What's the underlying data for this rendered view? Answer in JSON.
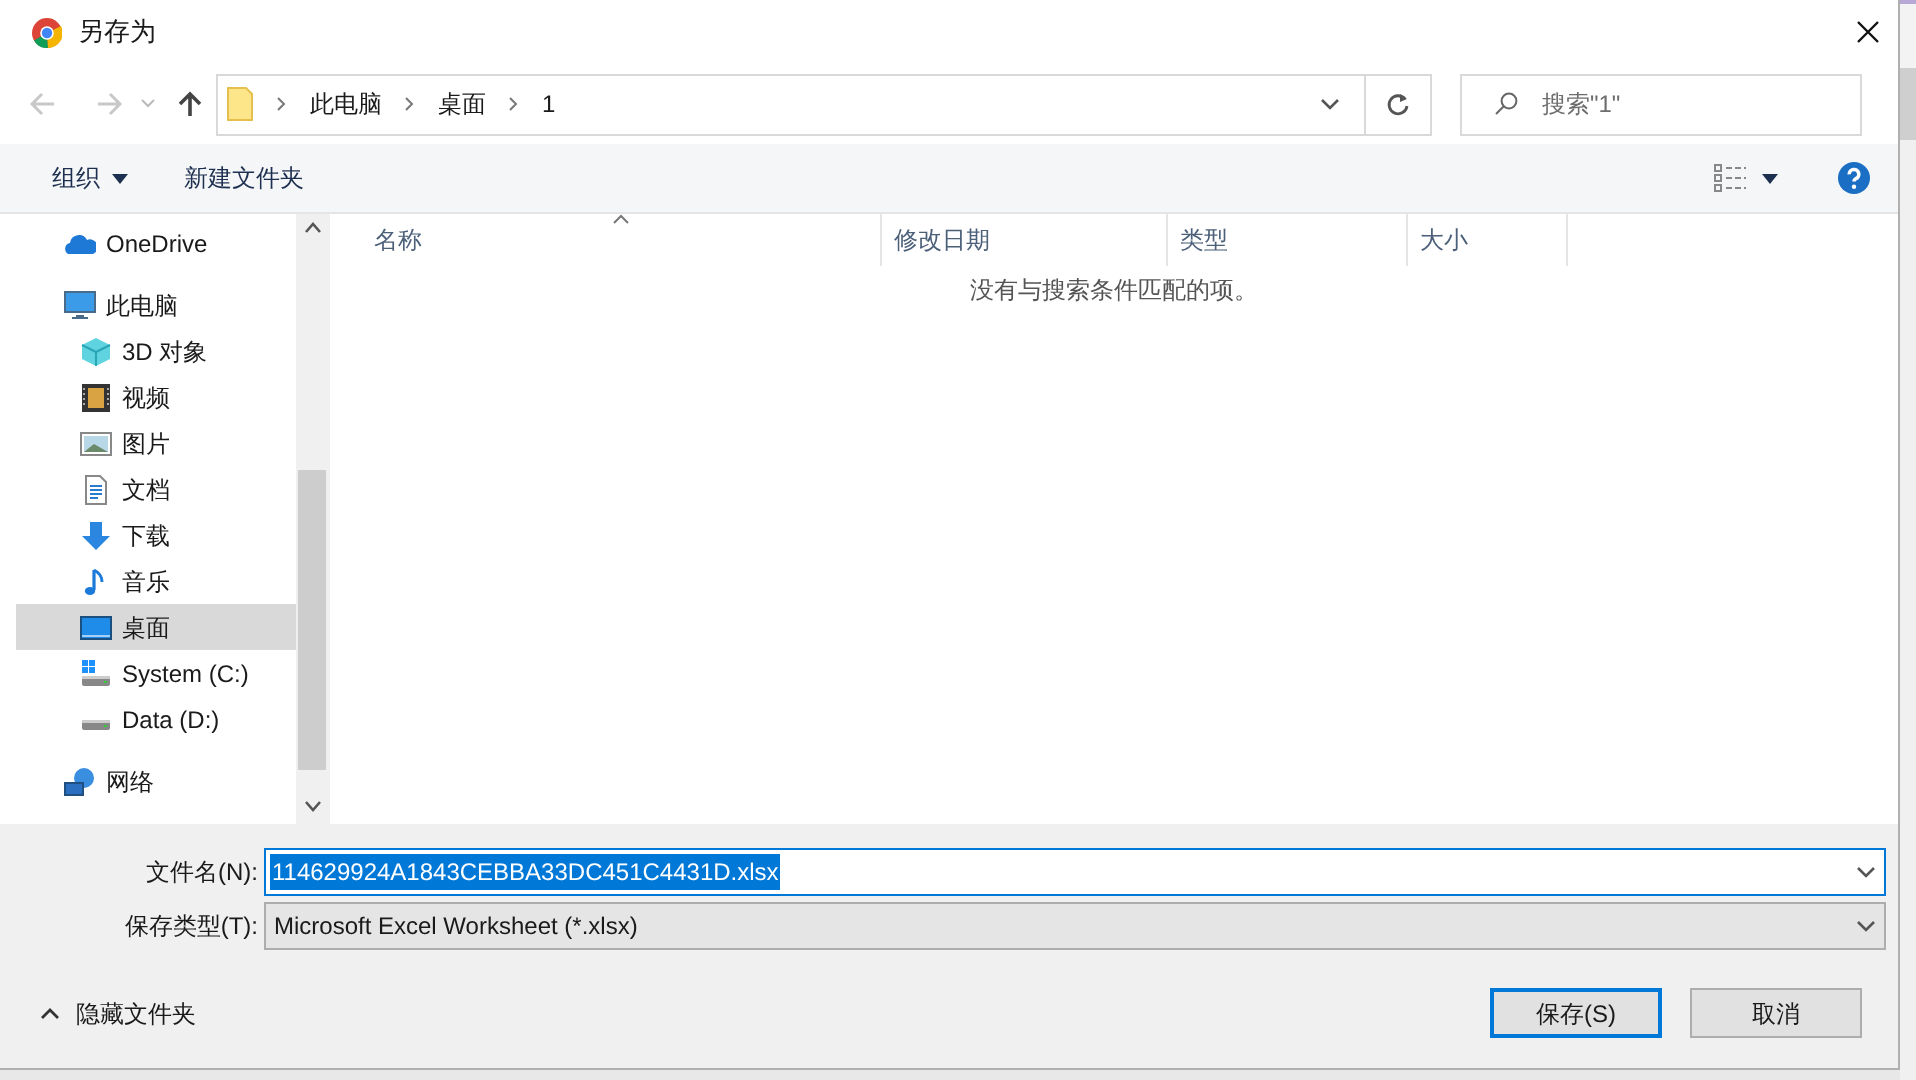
{
  "window": {
    "title": "另存为"
  },
  "nav": {
    "back_disabled": true,
    "forward_disabled": true,
    "breadcrumbs": [
      "此电脑",
      "桌面",
      "1"
    ],
    "search": {
      "placeholder": "搜索\"1\""
    }
  },
  "toolbar": {
    "organize": "组织",
    "new_folder": "新建文件夹"
  },
  "sidebar": {
    "items": [
      {
        "label": "OneDrive",
        "selected": false
      },
      {
        "label": "此电脑",
        "selected": false,
        "children": [
          {
            "label": "3D 对象",
            "selected": false
          },
          {
            "label": "视频",
            "selected": false
          },
          {
            "label": "图片",
            "selected": false
          },
          {
            "label": "文档",
            "selected": false
          },
          {
            "label": "下载",
            "selected": false
          },
          {
            "label": "音乐",
            "selected": false
          },
          {
            "label": "桌面",
            "selected": true
          },
          {
            "label": "System (C:)",
            "selected": false
          },
          {
            "label": "Data (D:)",
            "selected": false
          }
        ]
      },
      {
        "label": "网络",
        "selected": false
      }
    ]
  },
  "table": {
    "columns": [
      {
        "label": "名称",
        "sorted": true
      },
      {
        "label": "修改日期",
        "sorted": false
      },
      {
        "label": "类型",
        "sorted": false
      },
      {
        "label": "大小",
        "sorted": false
      }
    ],
    "empty_message": "没有与搜索条件匹配的项。"
  },
  "file_name": {
    "label": "文件名(N):",
    "value": "114629924A1843CEBBA33DC451C4431D.xlsx",
    "text_selected": true
  },
  "save_type": {
    "label": "保存类型(T):",
    "value": "Microsoft Excel Worksheet (*.xlsx)"
  },
  "hide_folders": {
    "label": "隐藏文件夹",
    "expanded": true
  },
  "buttons": [
    {
      "label": "保存(S)",
      "default": true
    },
    {
      "label": "取消",
      "default": false
    }
  ]
}
